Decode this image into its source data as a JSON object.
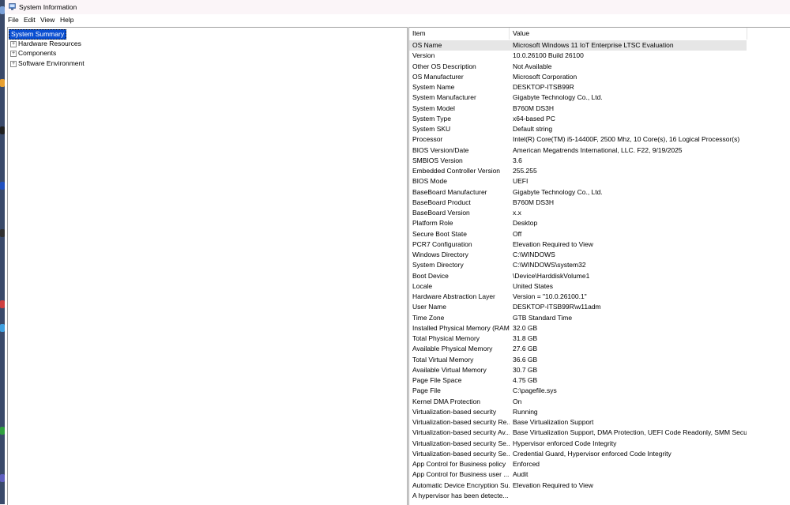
{
  "window": {
    "title": "System Information",
    "app_icon": "system-information-icon"
  },
  "menu": [
    "File",
    "Edit",
    "View",
    "Help"
  ],
  "tree": {
    "root": "System Summary",
    "children": [
      "Hardware Resources",
      "Components",
      "Software Environment"
    ],
    "expander": "⊞"
  },
  "table": {
    "headers": {
      "item": "Item",
      "value": "Value"
    },
    "rows": [
      {
        "item": "OS Name",
        "value": "Microsoft Windows 11 IoT Enterprise LTSC Evaluation"
      },
      {
        "item": "Version",
        "value": "10.0.26100 Build 26100"
      },
      {
        "item": "Other OS Description",
        "value": "Not Available"
      },
      {
        "item": "OS Manufacturer",
        "value": "Microsoft Corporation"
      },
      {
        "item": "System Name",
        "value": "DESKTOP-ITSB99R"
      },
      {
        "item": "System Manufacturer",
        "value": "Gigabyte Technology Co., Ltd."
      },
      {
        "item": "System Model",
        "value": "B760M DS3H"
      },
      {
        "item": "System Type",
        "value": "x64-based PC"
      },
      {
        "item": "System SKU",
        "value": "Default string"
      },
      {
        "item": "Processor",
        "value": "Intel(R) Core(TM) i5-14400F, 2500 Mhz, 10 Core(s), 16 Logical Processor(s)"
      },
      {
        "item": "BIOS Version/Date",
        "value": "American Megatrends International, LLC. F22, 9/19/2025"
      },
      {
        "item": "SMBIOS Version",
        "value": "3.6"
      },
      {
        "item": "Embedded Controller Version",
        "value": "255.255"
      },
      {
        "item": "BIOS Mode",
        "value": "UEFI"
      },
      {
        "item": "BaseBoard Manufacturer",
        "value": "Gigabyte Technology Co., Ltd."
      },
      {
        "item": "BaseBoard Product",
        "value": "B760M DS3H"
      },
      {
        "item": "BaseBoard Version",
        "value": "x.x"
      },
      {
        "item": "Platform Role",
        "value": "Desktop"
      },
      {
        "item": "Secure Boot State",
        "value": "Off"
      },
      {
        "item": "PCR7 Configuration",
        "value": "Elevation Required to View"
      },
      {
        "item": "Windows Directory",
        "value": "C:\\WINDOWS"
      },
      {
        "item": "System Directory",
        "value": "C:\\WINDOWS\\system32"
      },
      {
        "item": "Boot Device",
        "value": "\\Device\\HarddiskVolume1"
      },
      {
        "item": "Locale",
        "value": "United States"
      },
      {
        "item": "Hardware Abstraction Layer",
        "value": "Version = \"10.0.26100.1\""
      },
      {
        "item": "User Name",
        "value": "DESKTOP-ITSB99R\\w11adm"
      },
      {
        "item": "Time Zone",
        "value": "GTB Standard Time"
      },
      {
        "item": "Installed Physical Memory (RAM)",
        "value": "32.0 GB"
      },
      {
        "item": "Total Physical Memory",
        "value": "31.8 GB"
      },
      {
        "item": "Available Physical Memory",
        "value": "27.6 GB"
      },
      {
        "item": "Total Virtual Memory",
        "value": "36.6 GB"
      },
      {
        "item": "Available Virtual Memory",
        "value": "30.7 GB"
      },
      {
        "item": "Page File Space",
        "value": "4.75 GB"
      },
      {
        "item": "Page File",
        "value": "C:\\pagefile.sys"
      },
      {
        "item": "Kernel DMA Protection",
        "value": "On"
      },
      {
        "item": "Virtualization-based security",
        "value": "Running"
      },
      {
        "item": "Virtualization-based security Re...",
        "value": "Base Virtualization Support"
      },
      {
        "item": "Virtualization-based security Av...",
        "value": "Base Virtualization Support, DMA Protection, UEFI Code Readonly, SMM Secu..."
      },
      {
        "item": "Virtualization-based security Se...",
        "value": "Hypervisor enforced Code Integrity"
      },
      {
        "item": "Virtualization-based security Se...",
        "value": "Credential Guard, Hypervisor enforced Code Integrity"
      },
      {
        "item": "App Control for Business policy",
        "value": "Enforced"
      },
      {
        "item": "App Control for Business user ...",
        "value": "Audit"
      },
      {
        "item": "Automatic Device Encryption Su...",
        "value": "Elevation Required to View"
      },
      {
        "item": "A hypervisor has been detecte...",
        "value": ""
      }
    ]
  },
  "colors": {
    "selection": "#0a4fd2",
    "titlebar": "#fbf5f8",
    "row_highlight": "#e6e6e6"
  }
}
